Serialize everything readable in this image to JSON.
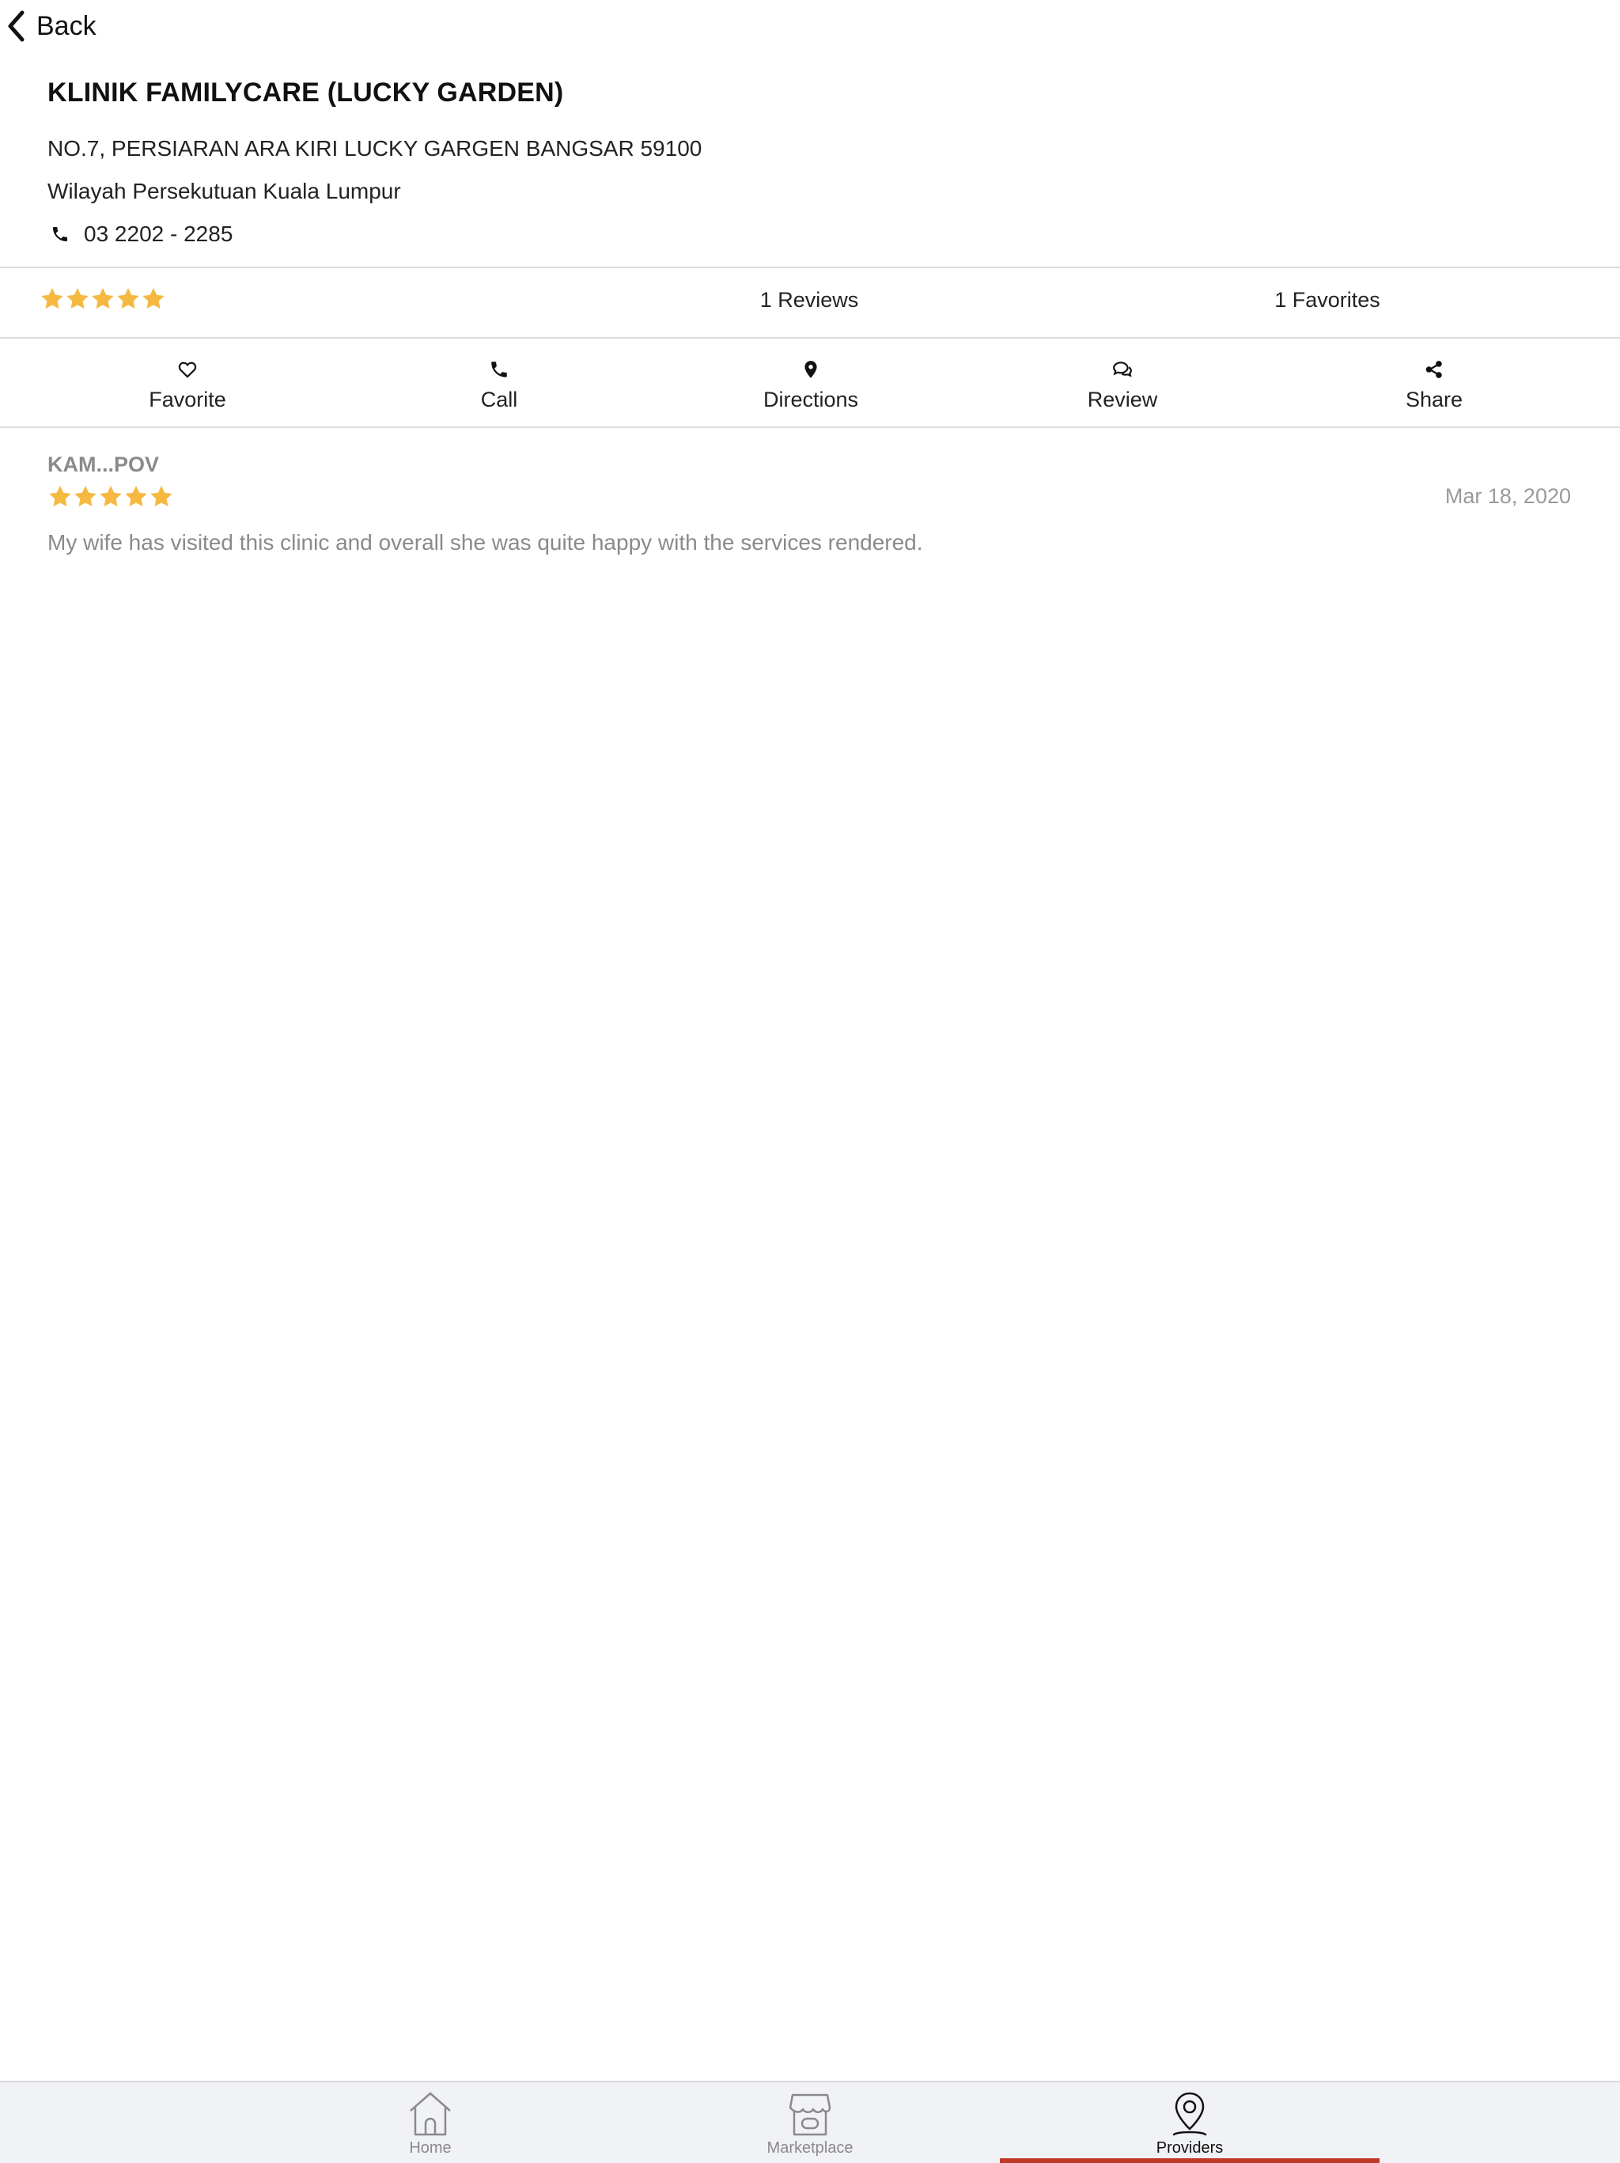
{
  "nav": {
    "back_label": "Back",
    "back_icon": "chevron-left-icon"
  },
  "clinic": {
    "name": "KLINIK FAMILYCARE (LUCKY GARDEN)",
    "address_line1": "NO.7, PERSIARAN ARA KIRI LUCKY GARGEN BANGSAR 59100",
    "address_line2": "Wilayah Persekutuan Kuala Lumpur",
    "phone": "03 2202 - 2285",
    "phone_icon": "phone-icon"
  },
  "stats": {
    "rating": 5,
    "rating_max": 5,
    "reviews_label": "1 Reviews",
    "favorites_label": "1 Favorites"
  },
  "actions": [
    {
      "label": "Favorite",
      "icon": "heart-icon"
    },
    {
      "label": "Call",
      "icon": "phone-icon"
    },
    {
      "label": "Directions",
      "icon": "map-marker-icon"
    },
    {
      "label": "Review",
      "icon": "comments-icon"
    },
    {
      "label": "Share",
      "icon": "share-icon"
    }
  ],
  "reviews": [
    {
      "author": "KAM...POV",
      "rating": 5,
      "date": "Mar 18, 2020",
      "text": "My wife has visited this clinic and overall she was quite happy with the services rendered."
    }
  ],
  "tabbar": {
    "tabs": [
      {
        "label": "Home",
        "icon": "home-icon"
      },
      {
        "label": "Marketplace",
        "icon": "storefront-icon"
      },
      {
        "label": "Providers",
        "icon": "location-pin-icon"
      }
    ],
    "active_index": 2
  },
  "colors": {
    "star": "#F5B942",
    "active_tab_indicator": "#C0392B",
    "muted_text": "#8A8A8A",
    "tabbar_background": "#F1F2F6"
  }
}
